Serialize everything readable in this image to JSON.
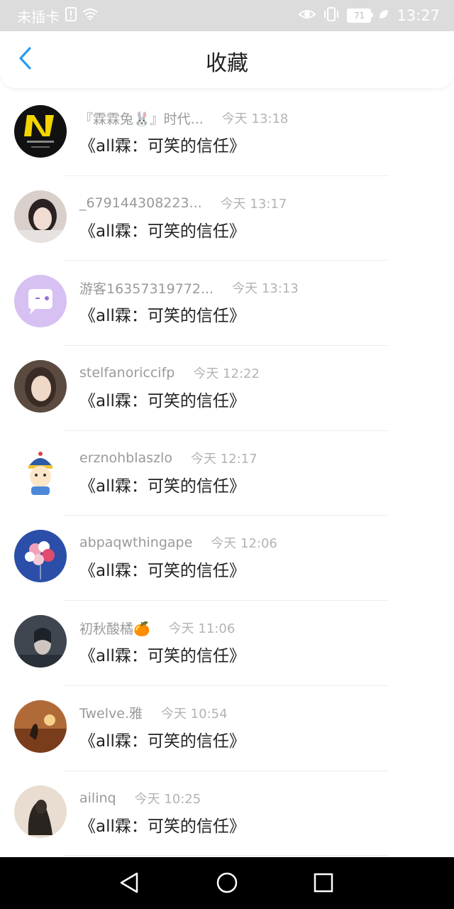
{
  "status_bar": {
    "carrier": "未插卡",
    "battery": "71",
    "time": "13:27"
  },
  "header": {
    "title": "收藏",
    "back_icon": "chevron-left-icon"
  },
  "colors": {
    "accent": "#2b9af3",
    "status_bar_bg": "#dcdcdc",
    "nav_bar_bg": "#000000"
  },
  "items": [
    {
      "username": "『霖霖兔🐰』时代...",
      "time": "今天 13:18",
      "title": "《all霖：可笑的信任》"
    },
    {
      "username": "_679144308223...",
      "time": "今天 13:17",
      "title": "《all霖：可笑的信任》"
    },
    {
      "username": "游客16357319772...",
      "time": "今天 13:13",
      "title": "《all霖：可笑的信任》"
    },
    {
      "username": "stelfanoriccifp",
      "time": "今天 12:22",
      "title": "《all霖：可笑的信任》"
    },
    {
      "username": "erznohblaszlo",
      "time": "今天 12:17",
      "title": "《all霖：可笑的信任》"
    },
    {
      "username": "abpaqwthingape",
      "time": "今天 12:06",
      "title": "《all霖：可笑的信任》"
    },
    {
      "username": "初秋酸橘🍊",
      "time": "今天 11:06",
      "title": "《all霖：可笑的信任》"
    },
    {
      "username": "Twelve.雅",
      "time": "今天 10:54",
      "title": "《all霖：可笑的信任》"
    },
    {
      "username": "ailinq",
      "time": "今天 10:25",
      "title": "《all霖：可笑的信任》"
    }
  ],
  "nav": {
    "back": "triangle-back-icon",
    "home": "circle-home-icon",
    "recents": "square-recents-icon"
  }
}
